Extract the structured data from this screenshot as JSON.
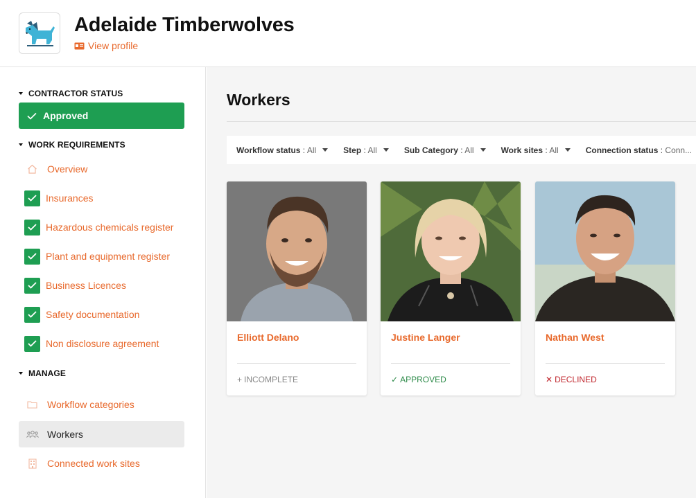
{
  "header": {
    "company_name": "Adelaide Timberwolves",
    "view_profile_label": "View profile",
    "logo_icon": "wolf-logo-icon"
  },
  "sidebar": {
    "contractor_status": {
      "heading": "CONTRACTOR STATUS",
      "status_label": "Approved",
      "status_color": "#1e9e52"
    },
    "work_requirements": {
      "heading": "WORK REQUIREMENTS",
      "items": [
        {
          "label": "Overview",
          "icon": "home-icon"
        },
        {
          "label": "Insurances",
          "icon": "check-icon"
        },
        {
          "label": "Hazardous chemicals register",
          "icon": "check-icon"
        },
        {
          "label": "Plant and equipment register",
          "icon": "check-icon"
        },
        {
          "label": "Business Licences",
          "icon": "check-icon"
        },
        {
          "label": "Safety documentation",
          "icon": "check-icon"
        },
        {
          "label": "Non disclosure agreement",
          "icon": "check-icon"
        }
      ]
    },
    "manage": {
      "heading": "MANAGE",
      "items": [
        {
          "label": "Workflow categories",
          "icon": "folder-icon"
        },
        {
          "label": "Workers",
          "icon": "people-icon",
          "active": true
        },
        {
          "label": "Connected work sites",
          "icon": "building-icon"
        }
      ]
    }
  },
  "main": {
    "title": "Workers",
    "filters": [
      {
        "label": "Workflow status",
        "value": "All"
      },
      {
        "label": "Step",
        "value": "All"
      },
      {
        "label": "Sub Category",
        "value": "All"
      },
      {
        "label": "Work sites",
        "value": "All"
      },
      {
        "label": "Connection status",
        "value": "Conn..."
      }
    ],
    "workers": [
      {
        "name": "Elliott Delano",
        "status": "INCOMPLETE",
        "status_symbol": "+",
        "status_color": "#888888"
      },
      {
        "name": "Justine Langer",
        "status": "APPROVED",
        "status_symbol": "✓",
        "status_color": "#2e8b4a"
      },
      {
        "name": "Nathan West",
        "status": "DECLINED",
        "status_symbol": "✕",
        "status_color": "#c0262d"
      }
    ]
  },
  "colors": {
    "accent": "#e8692c",
    "success": "#1e9e52",
    "danger": "#c0262d"
  }
}
